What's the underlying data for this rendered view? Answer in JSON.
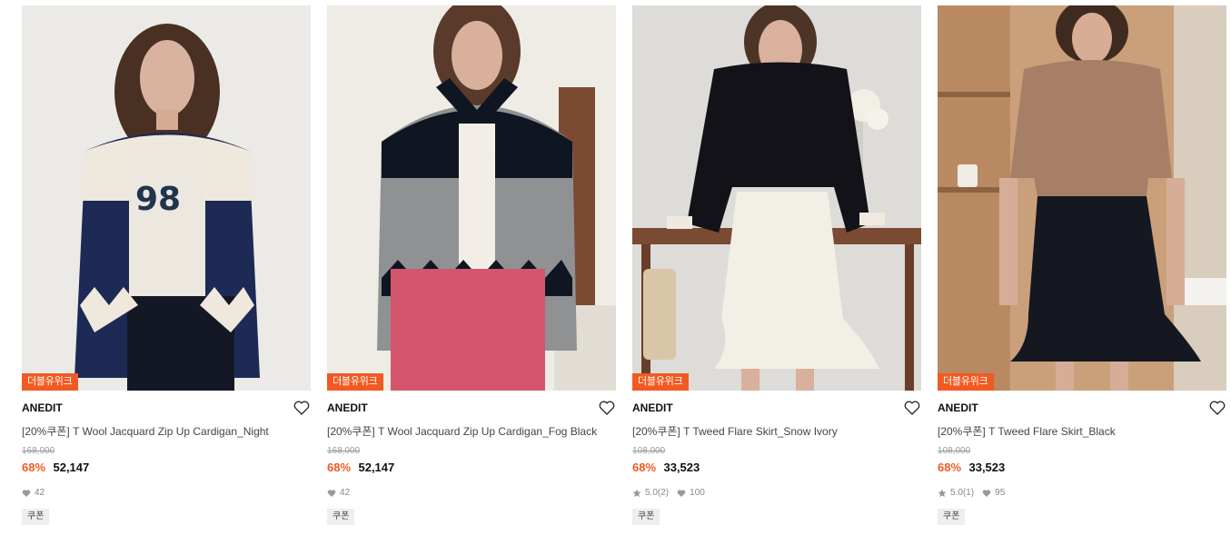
{
  "products": [
    {
      "badge": "더블유위크",
      "brand": "ANEDIT",
      "title": "[20%쿠폰] T Wool Jacquard Zip Up Cardigan_Night",
      "original_price": "168,000",
      "discount": "68%",
      "price": "52,147",
      "rating": "",
      "reviews": "",
      "likes": "42",
      "coupon": "쿠폰",
      "image_description": "model in navy and ivory jacquard zip cardigan"
    },
    {
      "badge": "더블유위크",
      "brand": "ANEDIT",
      "title": "[20%쿠폰] T Wool Jacquard Zip Up Cardigan_Fog Black",
      "original_price": "168,000",
      "discount": "68%",
      "price": "52,147",
      "rating": "",
      "reviews": "",
      "likes": "42",
      "coupon": "쿠폰",
      "image_description": "model in grey and black jacquard zip cardigan with pink skirt"
    },
    {
      "badge": "더블유위크",
      "brand": "ANEDIT",
      "title": "[20%쿠폰] T Tweed Flare Skirt_Snow Ivory",
      "original_price": "108,000",
      "discount": "68%",
      "price": "33,523",
      "rating": "5.0",
      "reviews": "(2)",
      "likes": "100",
      "coupon": "쿠폰",
      "image_description": "model in black top and ivory tweed flare skirt"
    },
    {
      "badge": "더블유위크",
      "brand": "ANEDIT",
      "title": "[20%쿠폰] T Tweed Flare Skirt_Black",
      "original_price": "108,000",
      "discount": "68%",
      "price": "33,523",
      "rating": "5.0",
      "reviews": "(1)",
      "likes": "95",
      "coupon": "쿠폰",
      "image_description": "model in brown knit top and black tweed flare skirt"
    }
  ],
  "colors": {
    "accent": "#f15a22",
    "muted": "#888888"
  }
}
